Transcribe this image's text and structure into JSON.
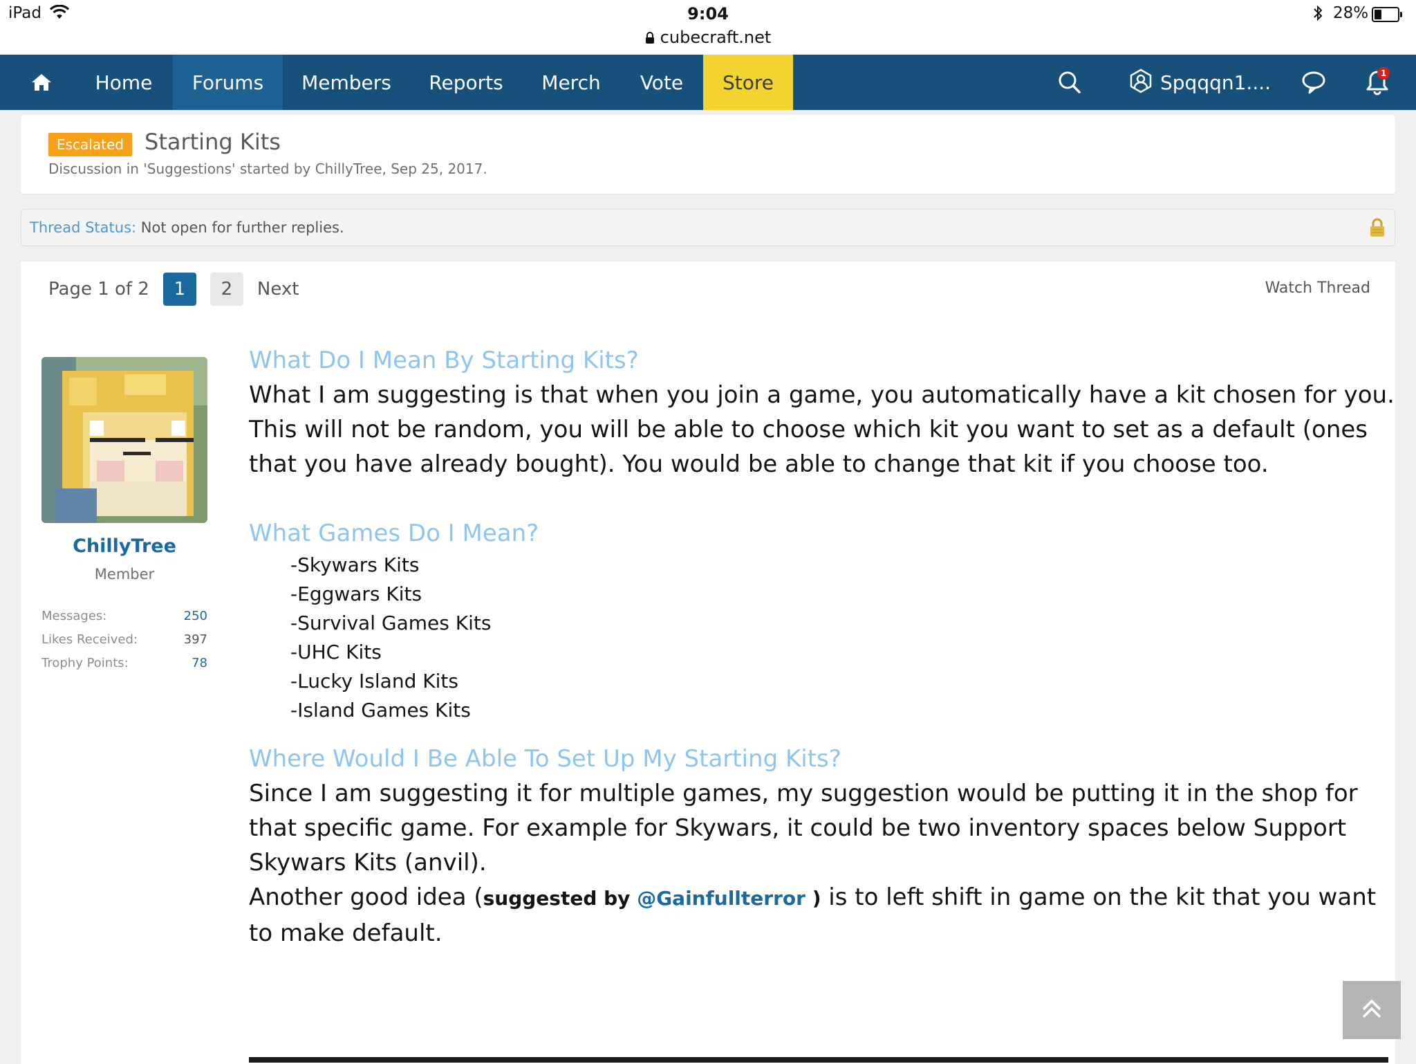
{
  "status_bar": {
    "device": "iPad",
    "time": "9:04",
    "url": "cubecraft.net",
    "battery": "28%"
  },
  "nav": {
    "tabs": [
      {
        "label": "Home"
      },
      {
        "label": "Forums"
      },
      {
        "label": "Members"
      },
      {
        "label": "Reports"
      },
      {
        "label": "Merch"
      },
      {
        "label": "Vote"
      },
      {
        "label": "Store"
      }
    ],
    "active_tab": "Forums",
    "username": "Spqqqn1....",
    "notification_count": "1",
    "icons": [
      "home-icon",
      "search-icon",
      "user-icon",
      "chat-icon",
      "bell-icon"
    ]
  },
  "thread": {
    "prefix": "Escalated",
    "title": "Starting Kits",
    "meta": "Discussion in 'Suggestions' started by ChillyTree, Sep 25, 2017."
  },
  "notice": {
    "label": "Thread Status:",
    "value": "Not open for further replies."
  },
  "pagination": {
    "label": "Page 1 of 2",
    "pages": [
      "1",
      "2"
    ],
    "current": "1",
    "next": "Next",
    "watch": "Watch Thread"
  },
  "user": {
    "name": "ChillyTree",
    "title": "Member",
    "stats": [
      {
        "key": "Messages:",
        "value": "250"
      },
      {
        "key": "Likes Received:",
        "value": "397"
      },
      {
        "key": "Trophy Points:",
        "value": "78"
      }
    ]
  },
  "post": {
    "h1": "What Do I Mean By Starting Kits?",
    "p1": "What I am suggesting is that when you join a game, you automatically have a kit chosen for you. This will not be random, you will be able to choose which kit you want to set as a default (ones that you have already bought). You would be able to change that kit if you choose too.",
    "h2": "What Games Do I Mean?",
    "games": [
      "-Skywars Kits",
      "-Eggwars Kits",
      "-Survival Games Kits",
      "-UHC Kits",
      "-Lucky Island Kits",
      "-Island Games Kits"
    ],
    "h3": "Where Would I Be Able To Set Up My Starting Kits?",
    "p3": "Since I am suggesting it for multiple games, my suggestion would be putting it in the shop for that specific game. For example for Skywars, it could be two inventory spaces below Support Skywars Kits (anvil).",
    "p4_start": "Another good idea (",
    "p4_suggested": "suggested by",
    "p4_mention": "@Gainfullterror",
    "p4_close": ")",
    "p4_end": " is to left shift in game on the kit that you want to make default."
  },
  "colors": {
    "nav_bg": "#17507a",
    "nav_active": "#1e6193",
    "store_bg": "#f2d431",
    "badge": "#f7a11a",
    "heading": "#8cc5f0",
    "link": "#1b6a9f"
  }
}
